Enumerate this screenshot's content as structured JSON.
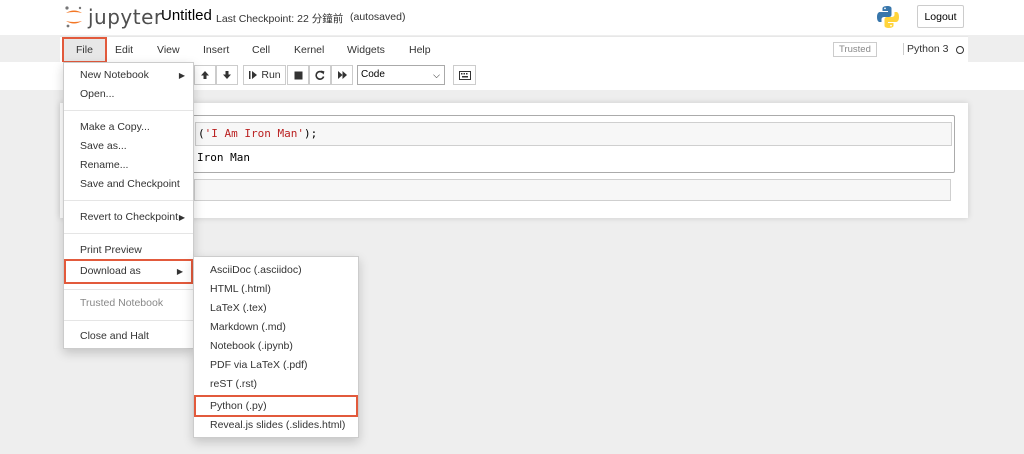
{
  "header": {
    "logo_text": "jupyter",
    "notebook_title": "Untitled",
    "checkpoint_text": "Last Checkpoint: 22 分鐘前",
    "autosave_text": "(autosaved)",
    "logout_label": "Logout"
  },
  "menubar": {
    "items": [
      "File",
      "Edit",
      "View",
      "Insert",
      "Cell",
      "Kernel",
      "Widgets",
      "Help"
    ],
    "trusted_label": "Trusted",
    "kernel_name": "Python 3"
  },
  "toolbar": {
    "run_label": "Run",
    "cell_type": "Code"
  },
  "notebook": {
    "code_prefix": "(",
    "code_string": "'I Am Iron Man'",
    "code_suffix": ");",
    "output_text": "Iron Man"
  },
  "file_menu": {
    "new_notebook": "New Notebook",
    "open": "Open...",
    "make_copy": "Make a Copy...",
    "save_as": "Save as...",
    "rename": "Rename...",
    "save_checkpoint": "Save and Checkpoint",
    "revert": "Revert to Checkpoint",
    "print_preview": "Print Preview",
    "download_as": "Download as",
    "trusted_notebook": "Trusted Notebook",
    "close_halt": "Close and Halt"
  },
  "download_menu": {
    "items": [
      "AsciiDoc (.asciidoc)",
      "HTML (.html)",
      "LaTeX (.tex)",
      "Markdown (.md)",
      "Notebook (.ipynb)",
      "PDF via LaTeX (.pdf)",
      "reST (.rst)",
      "Python (.py)",
      "Reveal.js slides (.slides.html)"
    ]
  },
  "colors": {
    "highlight_border": "#e25a3c",
    "jupyter_orange": "#f37726",
    "string_red": "#ba2121"
  },
  "icons": [
    "jupyter-logo-icon",
    "python-logo-icon",
    "arrow-up-icon",
    "arrow-down-icon",
    "step-run-icon",
    "stop-icon",
    "restart-icon",
    "fast-forward-icon",
    "keyboard-icon",
    "caret-right-icon",
    "circle-icon"
  ]
}
